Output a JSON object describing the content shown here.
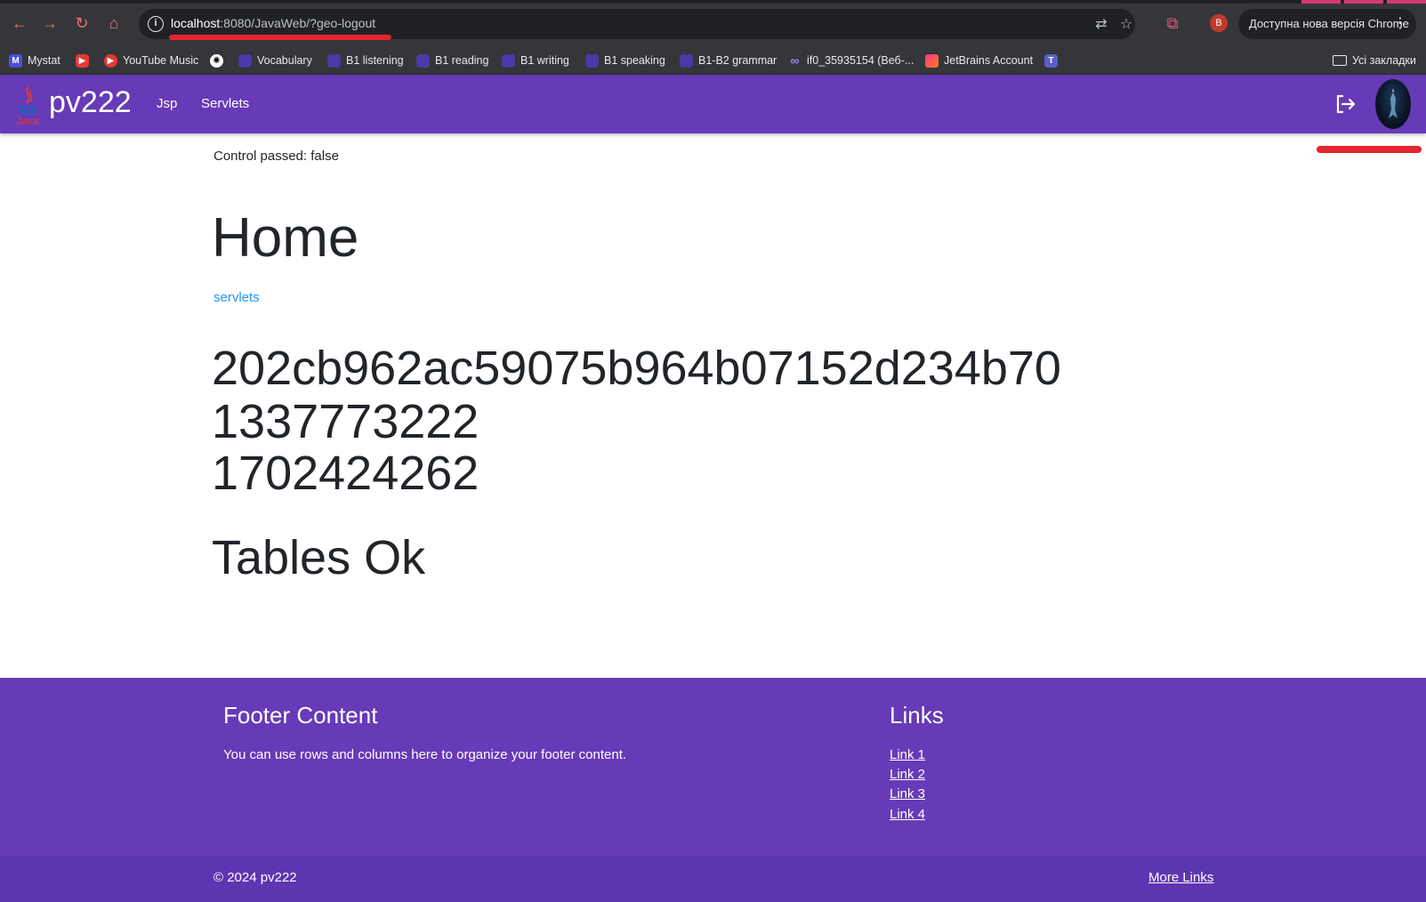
{
  "browser": {
    "url_host": "localhost",
    "url_rest": ":8080/JavaWeb/?geo-logout",
    "profile_initial": "B",
    "update_label": "Доступна нова версія Chrome",
    "bookmarks": [
      {
        "label": "Mystat",
        "icon": "mystat-icon"
      },
      {
        "label": "",
        "icon": "youtube-icon"
      },
      {
        "label": "YouTube Music",
        "icon": "youtube-music-icon"
      },
      {
        "label": "",
        "icon": "chatgpt-icon"
      },
      {
        "label": "Vocabulary",
        "icon": "grid-app-icon"
      },
      {
        "label": "B1 listening",
        "icon": "grid-app-icon"
      },
      {
        "label": "B1 reading",
        "icon": "grid-app-icon"
      },
      {
        "label": "B1 writing",
        "icon": "grid-app-icon"
      },
      {
        "label": "B1 speaking",
        "icon": "grid-app-icon"
      },
      {
        "label": "B1-B2 grammar",
        "icon": "grid-app-icon"
      },
      {
        "label": "if0_35935154 (Веб-...",
        "icon": "infinity-icon"
      },
      {
        "label": "JetBrains Account",
        "icon": "jetbrains-icon"
      },
      {
        "label": "",
        "icon": "teams-icon"
      }
    ],
    "all_bookmarks_label": "Усі закладки"
  },
  "navbar": {
    "logo_text": "Java",
    "brand": "pv222",
    "links": [
      "Jsp",
      "Servlets"
    ]
  },
  "main": {
    "control_text": "Control passed: false",
    "title": "Home",
    "servlets_link": "servlets",
    "lines": [
      "202cb962ac59075b964b07152d234b70",
      "1337773222",
      "1702424262"
    ],
    "tables_status": "Tables Ok"
  },
  "footer": {
    "content_title": "Footer Content",
    "content_text": "You can use rows and columns here to organize your footer content.",
    "links_title": "Links",
    "links": [
      "Link 1",
      "Link 2",
      "Link 3",
      "Link 4"
    ],
    "copyright": "© 2024 pv222",
    "more_links": "More Links"
  },
  "colors": {
    "brand_purple": "#673ab7",
    "link_blue": "#2196f3",
    "annotation_red": "#e5242f"
  }
}
